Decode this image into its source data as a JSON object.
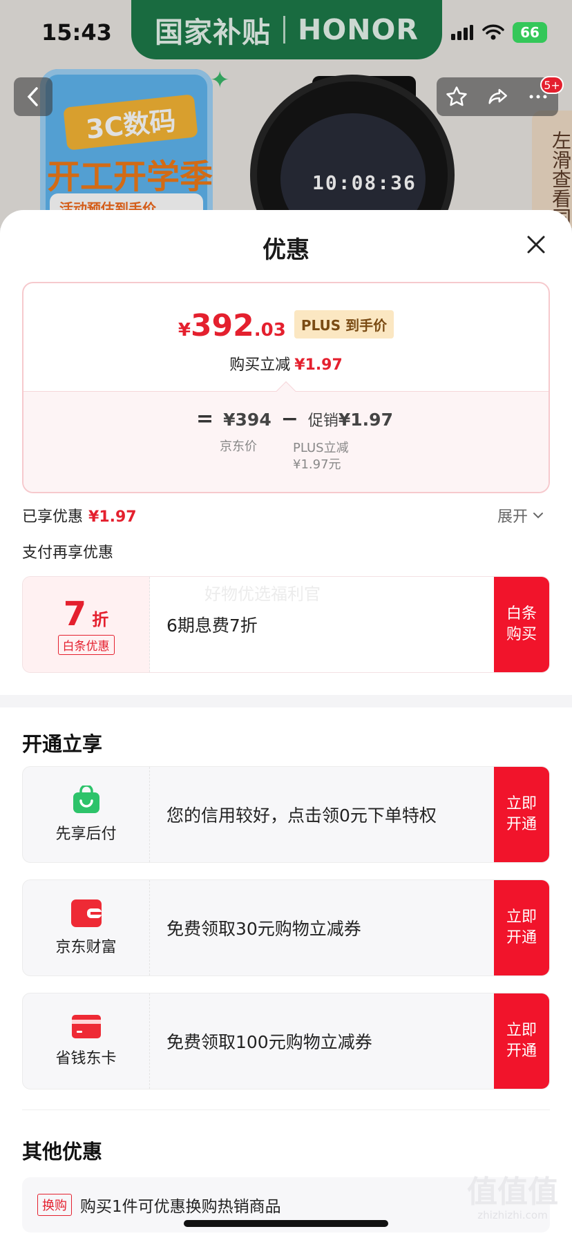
{
  "status_bar": {
    "time": "15:43",
    "battery": "66"
  },
  "backdrop": {
    "banner_left": "国家补贴",
    "banner_right": "HONOR",
    "promo_tag": "3C数码",
    "promo_title": "开工开学季",
    "promo_sub": "活动预估到手价",
    "watch_time": "10:08:36",
    "notification_count": "5+",
    "slide_hint": "左滑查看国"
  },
  "sheet": {
    "title": "优惠",
    "price_card": {
      "currency": "¥",
      "price_int": "392",
      "price_dec": ".03",
      "plus_tag": "PLUS 到手价",
      "discount_label": "购买立减",
      "discount_value": "¥1.97",
      "formula_eq": "=",
      "jd_price": "¥394",
      "minus": "−",
      "promo_label": "促销",
      "promo_value": "¥1.97",
      "jd_price_label": "京东价",
      "plus_line1": "PLUS立减",
      "plus_line2": "¥1.97元"
    },
    "enjoyed_label": "已享优惠",
    "enjoyed_value": "¥1.97",
    "expand_label": "展开",
    "pay_more_label": "支付再享优惠",
    "baitiao": {
      "discount_num": "7",
      "discount_unit": "折",
      "tag": "白条优惠",
      "watermark": "好物优选福利官",
      "desc": "6期息费7折",
      "button": "白条购买"
    },
    "open_section_title": "开通立享",
    "open_offers": [
      {
        "name": "先享后付",
        "desc": "您的信用较好，点击领0元下单特权",
        "button": "立即开通",
        "icon": "shopping-bag-icon"
      },
      {
        "name": "京东财富",
        "desc": "免费领取30元购物立减券",
        "button": "立即开通",
        "icon": "wallet-icon"
      },
      {
        "name": "省钱东卡",
        "desc": "免费领取100元购物立减券",
        "button": "立即开通",
        "icon": "card-icon"
      }
    ],
    "other_section_title": "其他优惠",
    "other_offer": {
      "tag": "换购",
      "text": "购买1件可优惠换购热销商品"
    },
    "brand_watermark": "值值值",
    "brand_watermark_url": "zhizhizhi.com"
  },
  "colors": {
    "accent": "#e4202e",
    "button": "#f1142b",
    "plus_tag_bg": "#fbe7c2",
    "banner_green": "#1d7a49"
  }
}
